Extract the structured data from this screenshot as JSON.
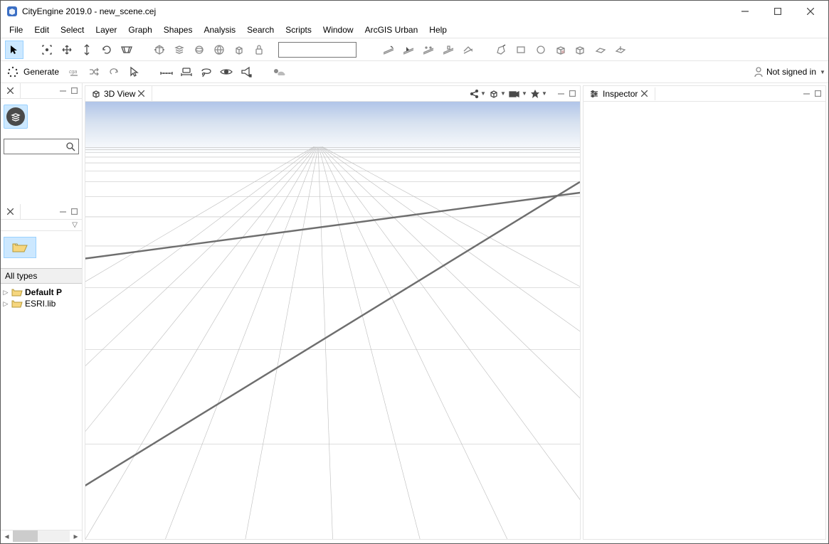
{
  "titlebar": {
    "title": "CityEngine 2019.0 - new_scene.cej"
  },
  "menu": {
    "items": [
      "File",
      "Edit",
      "Select",
      "Layer",
      "Graph",
      "Shapes",
      "Analysis",
      "Search",
      "Scripts",
      "Window",
      "ArcGIS Urban",
      "Help"
    ]
  },
  "toolbar2": {
    "generate": "Generate"
  },
  "account": {
    "label": "Not signed in"
  },
  "leftLower": {
    "typeFilter": "All types",
    "tree": [
      {
        "label": "Default P",
        "bold": true
      },
      {
        "label": "ESRI.lib",
        "bold": false
      }
    ]
  },
  "view3d": {
    "tabLabel": "3D View"
  },
  "inspector": {
    "tabLabel": "Inspector"
  }
}
